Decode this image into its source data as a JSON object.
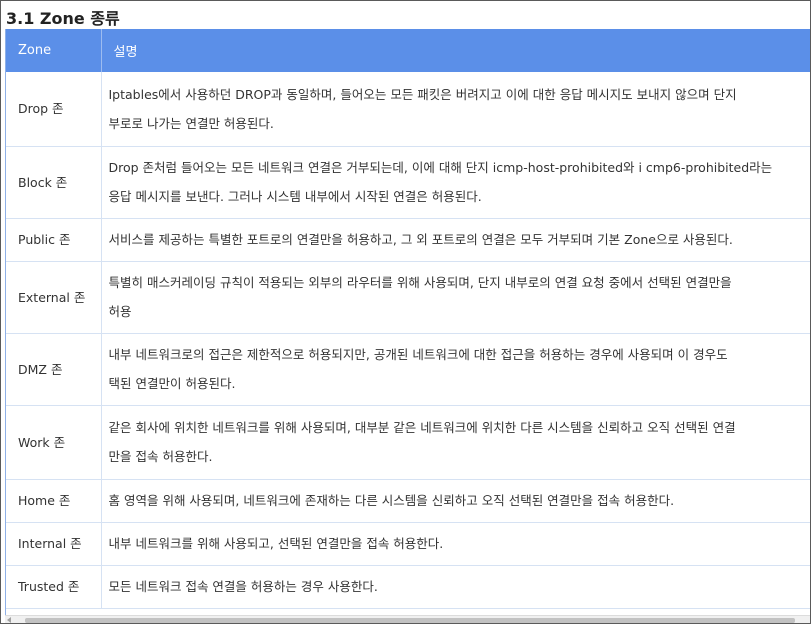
{
  "section_title": "3.1 Zone 종류",
  "table": {
    "headers": [
      "Zone",
      "설명"
    ],
    "rows": [
      {
        "zone": "Drop 존",
        "lines": [
          "Iptables에서 사용하던 DROP과 동일하며, 들어오는 모든 패킷은 버려지고 이에 대한 응답 메시지도 보내지 않으며 단지",
          "부로로 나가는 연결만 허용된다."
        ]
      },
      {
        "zone": "Block 존",
        "lines": [
          "Drop 존처럼 들어오는 모든 네트워크 연결은 거부되는데, 이에 대해 단지 icmp-host-prohibited와 i cmp6-prohibited라는",
          "응답 메시지를 보낸다. 그러나 시스템 내부에서 시작된 연결은 허용된다."
        ]
      },
      {
        "zone": "Public 존",
        "lines": [
          "서비스를 제공하는 특별한 포트로의 연결만을 허용하고, 그 외 포트로의 연결은 모두 거부되며 기본 Zone으로 사용된다."
        ]
      },
      {
        "zone": "External 존",
        "lines": [
          "특별히 매스커레이딩 규칙이 적용되는 외부의 라우터를 위해 사용되며, 단지 내부로의 연결 요청 중에서 선택된 연결만을",
          "허용"
        ]
      },
      {
        "zone": "DMZ 존",
        "lines": [
          "내부 네트워크로의 접근은 제한적으로 허용되지만, 공개된 네트워크에 대한 접근을 허용하는 경우에 사용되며 이 경우도",
          "택된 연결만이 허용된다."
        ]
      },
      {
        "zone": "Work 존",
        "lines": [
          "같은 회사에 위치한 네트워크를 위해 사용되며, 대부분 같은 네트워크에 위치한 다른 시스템을 신뢰하고 오직 선택된 연결",
          "만을 접속 허용한다."
        ]
      },
      {
        "zone": "Home 존",
        "lines": [
          "홈 영역을 위해 사용되며, 네트워크에 존재하는 다른 시스템을 신뢰하고 오직 선택된 연결만을 접속 허용한다."
        ]
      },
      {
        "zone": "Internal 존",
        "lines": [
          "내부 네트워크를 위해 사용되고, 선택된 연결만을 접속 허용한다."
        ]
      },
      {
        "zone": "Trusted 존",
        "lines": [
          "모든 네트워크 접속 연결을 허용하는 경우 사용한다."
        ]
      }
    ]
  },
  "colors": {
    "header_bg": "#5b8fe8",
    "header_text": "#ffffff",
    "row_border": "#d6e2f3"
  },
  "icons": [
    "scroll-left-arrow-icon"
  ]
}
